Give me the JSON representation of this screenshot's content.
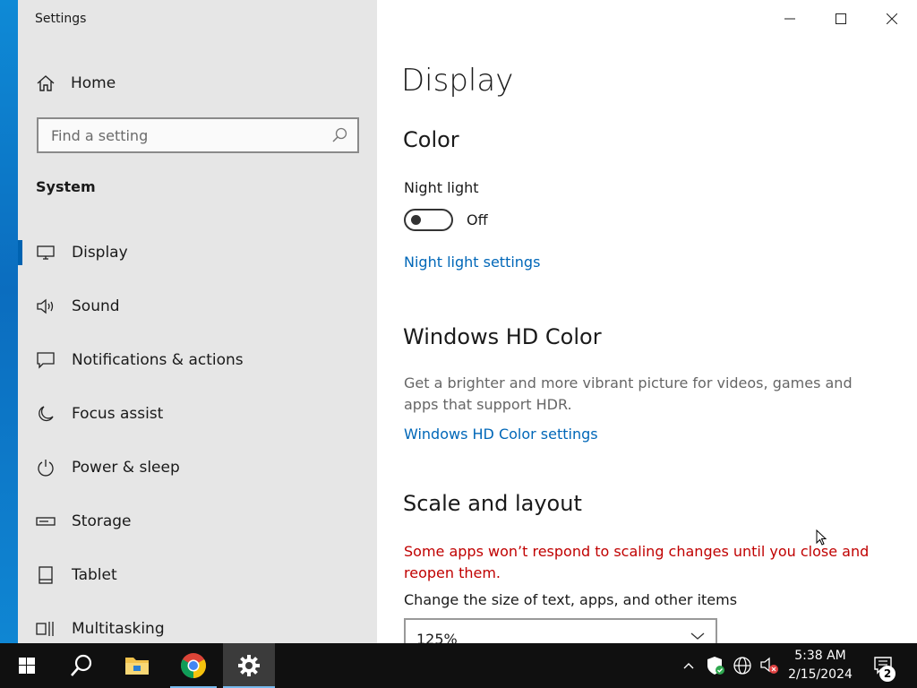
{
  "app": {
    "title": "Settings"
  },
  "sidebar": {
    "home_label": "Home",
    "search_placeholder": "Find a setting",
    "section_title": "System",
    "items": [
      {
        "label": "Display",
        "icon": "monitor-icon",
        "active": true
      },
      {
        "label": "Sound",
        "icon": "speaker-icon"
      },
      {
        "label": "Notifications & actions",
        "icon": "notification-icon"
      },
      {
        "label": "Focus assist",
        "icon": "moon-icon"
      },
      {
        "label": "Power & sleep",
        "icon": "power-icon"
      },
      {
        "label": "Storage",
        "icon": "storage-icon"
      },
      {
        "label": "Tablet",
        "icon": "tablet-icon"
      },
      {
        "label": "Multitasking",
        "icon": "multitasking-icon"
      }
    ]
  },
  "content": {
    "page_title": "Display",
    "color": {
      "heading": "Color",
      "night_light_label": "Night light",
      "night_light_state": "Off",
      "night_light_on": false,
      "night_light_settings_link": "Night light settings"
    },
    "hdr": {
      "heading": "Windows HD Color",
      "description": "Get a brighter and more vibrant picture for videos, games and apps that support HDR.",
      "settings_link": "Windows HD Color settings"
    },
    "scale": {
      "heading": "Scale and layout",
      "warning": "Some apps won’t respond to scaling changes until you close and reopen them.",
      "size_label": "Change the size of text, apps, and other items",
      "size_value": "125%"
    }
  },
  "taskbar": {
    "time": "5:38 AM",
    "date": "2/15/2024",
    "notification_count": "2",
    "apps": [
      "start-button",
      "search-button",
      "file-explorer",
      "chrome",
      "settings"
    ]
  },
  "colors": {
    "accent": "#0063b1",
    "link": "#0067b8",
    "warning": "#c00000",
    "sidebar_bg": "#e6e6e6",
    "taskbar_bg": "#101010"
  }
}
